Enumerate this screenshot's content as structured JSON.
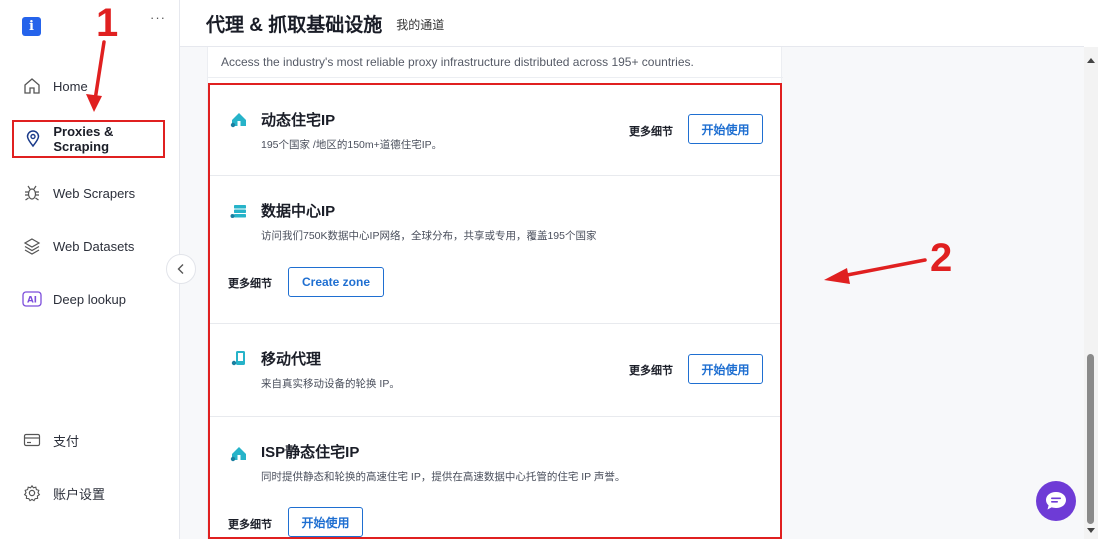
{
  "app": {
    "logo_letter": "i"
  },
  "sidebar": {
    "more": "···",
    "items": [
      {
        "label": "Home",
        "icon": "home-icon"
      },
      {
        "label": "Proxies & Scraping",
        "icon": "location-pin-icon",
        "active": true
      },
      {
        "label": "Web Scrapers",
        "icon": "bug-icon"
      },
      {
        "label": "Web Datasets",
        "icon": "layers-icon"
      },
      {
        "label": "Deep lookup",
        "icon": "ai-icon",
        "badge": "AI"
      },
      {
        "label": "支付",
        "icon": "credit-card-icon"
      },
      {
        "label": "账户设置",
        "icon": "gear-icon"
      }
    ]
  },
  "header": {
    "title": "代理 & 抓取基础设施",
    "subtitle": "我的通道"
  },
  "main": {
    "intro": "Access the industry's most reliable proxy infrastructure distributed across 195+ countries.",
    "cards": [
      {
        "title": "动态住宅IP",
        "desc": "195个国家 /地区的150m+道德住宅IP。",
        "more": "更多细节",
        "button": "开始使用",
        "icon": "residential-icon"
      },
      {
        "title": "数据中心IP",
        "desc": "访问我们750K数据中心IP网络，全球分布，共享或专用，覆盖195个国家",
        "more": "更多细节",
        "button": "Create zone",
        "icon": "datacenter-icon"
      },
      {
        "title": "移动代理",
        "desc": "来自真实移动设备的轮换 IP。",
        "more": "更多细节",
        "button": "开始使用",
        "icon": "mobile-icon"
      },
      {
        "title": "ISP静态住宅IP",
        "desc": "同时提供静态和轮换的高速住宅 IP，提供在高速数据中心托管的住宅 IP 声誉。",
        "more": "更多细节",
        "button": "开始使用",
        "icon": "isp-residential-icon"
      }
    ]
  },
  "annotations": {
    "one": "1",
    "two": "2"
  },
  "colors": {
    "accent": "#1f6fd1",
    "annotation": "#e02020",
    "chat": "#6e3bd6",
    "icon_teal": "#26b3c9"
  }
}
